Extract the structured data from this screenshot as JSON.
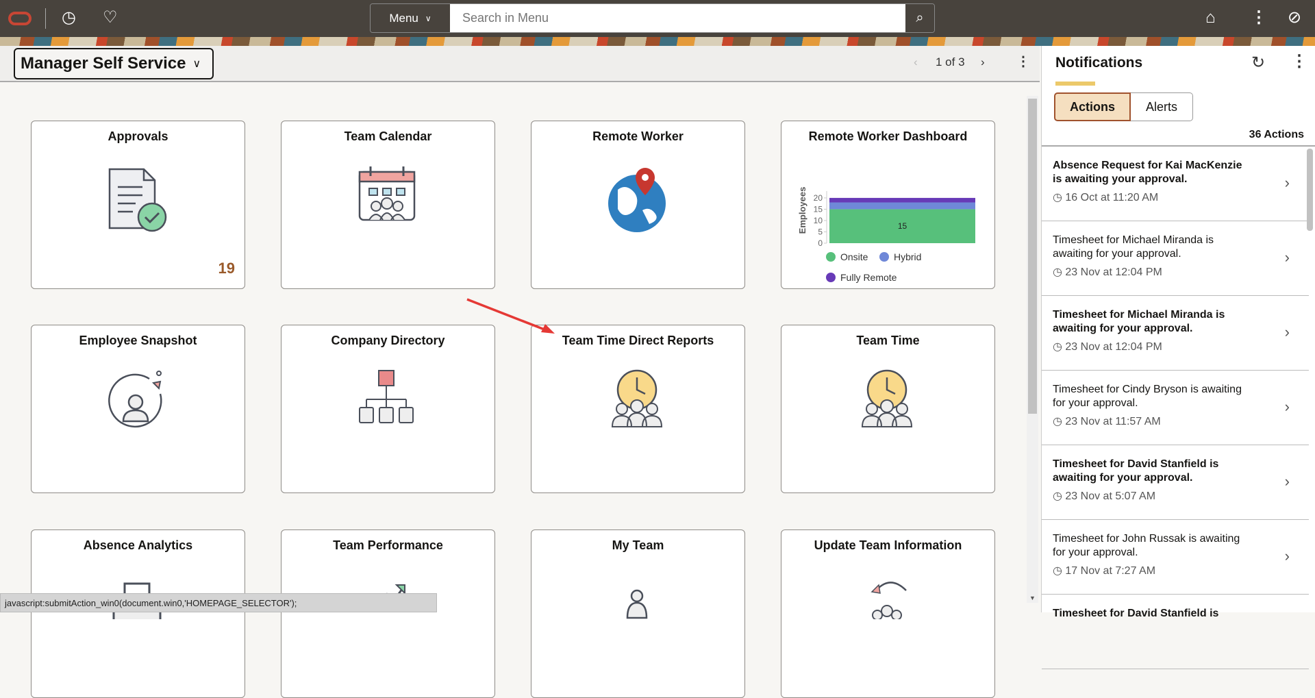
{
  "header": {
    "menu_label": "Menu",
    "search_placeholder": "Search in Menu"
  },
  "titlebar": {
    "homepage": "Manager Self Service",
    "page_indicator": "1 of 3"
  },
  "tiles": [
    {
      "title": "Approvals",
      "badge": "19"
    },
    {
      "title": "Team Calendar"
    },
    {
      "title": "Remote Worker"
    },
    {
      "title": "Remote Worker Dashboard"
    },
    {
      "title": "Employee Snapshot"
    },
    {
      "title": "Company Directory"
    },
    {
      "title": "Team Time Direct Reports"
    },
    {
      "title": "Team Time"
    },
    {
      "title": "Absence Analytics"
    },
    {
      "title": "Team Performance"
    },
    {
      "title": "My Team"
    },
    {
      "title": "Update Team Information"
    }
  ],
  "chart_data": {
    "type": "bar",
    "stacked": true,
    "categories": [
      ""
    ],
    "series": [
      {
        "name": "Onsite",
        "values": [
          15
        ],
        "color": "#57c07b"
      },
      {
        "name": "Hybrid",
        "values": [
          3
        ],
        "color": "#6f88d8"
      },
      {
        "name": "Fully Remote",
        "values": [
          2
        ],
        "color": "#673ab7"
      }
    ],
    "data_label": "15",
    "ylabel": "Employees",
    "yticks": [
      "0",
      "5",
      "10",
      "15",
      "20"
    ],
    "ylim": [
      0,
      23
    ],
    "legend": "bottom"
  },
  "notifications": {
    "title": "Notifications",
    "tab_actions": "Actions",
    "tab_alerts": "Alerts",
    "count": "36 Actions",
    "items": [
      {
        "msg": "Absence Request for Kai MacKenzie is awaiting your approval.",
        "time": "16 Oct at 11:20 AM",
        "bold": true
      },
      {
        "msg": "Timesheet for Michael Miranda is awaiting for your approval.",
        "time": "23 Nov at 12:04 PM",
        "bold": false
      },
      {
        "msg": "Timesheet for Michael Miranda is awaiting for your approval.",
        "time": "23 Nov at 12:04 PM",
        "bold": true
      },
      {
        "msg": "Timesheet for Cindy Bryson is awaiting for your approval.",
        "time": "23 Nov at 11:57 AM",
        "bold": false
      },
      {
        "msg": "Timesheet for David Stanfield is awaiting for your approval.",
        "time": "23 Nov at 5:07 AM",
        "bold": true
      },
      {
        "msg": "Timesheet for John Russak is awaiting for your approval.",
        "time": "17 Nov at 7:27 AM",
        "bold": false
      },
      {
        "msg": "Timesheet for David Stanfield is",
        "time": "",
        "bold": true
      }
    ]
  },
  "statusbar": "javascript:submitAction_win0(document.win0,'HOMEPAGE_SELECTOR');"
}
